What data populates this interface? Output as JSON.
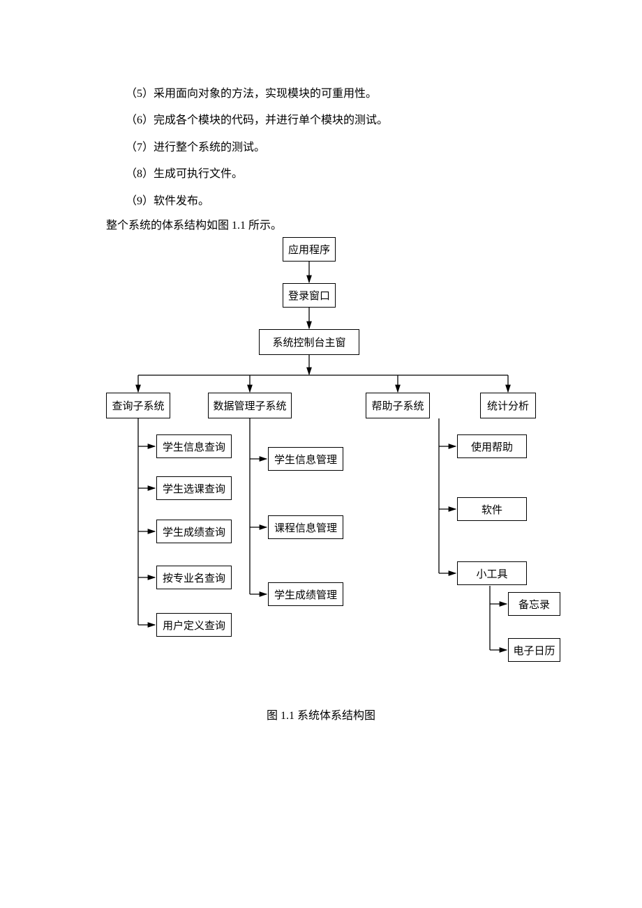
{
  "steps": {
    "s5": "（5）采用面向对象的方法，实现模块的可重用性。",
    "s6": "（6）完成各个模块的代码，并进行单个模块的测试。",
    "s7": "（7）进行整个系统的测试。",
    "s8": "（8）生成可执行文件。",
    "s9": "（9）软件发布。"
  },
  "summary": "整个系统的体系结构如图 1.1 所示。",
  "caption": "图 1.1 系统体系结构图",
  "nodes": {
    "app": "应用程序",
    "login": "登录窗口",
    "console": "系统控制台主窗",
    "query": "查询子系统",
    "datamgr": "数据管理子系统",
    "help": "帮助子系统",
    "stats": "统计分析",
    "q1": "学生信息查询",
    "q2": "学生选课查询",
    "q3": "学生成绩查询",
    "q4": "按专业名查询",
    "q5": "用户定义查询",
    "d1": "学生信息管理",
    "d2": "课程信息管理",
    "d3": "学生成绩管理",
    "h1": "使用帮助",
    "h2": "软件",
    "h3": "小工具",
    "h3a": "备忘录",
    "h3b": "电子日历"
  },
  "chart_data": {
    "type": "hierarchy",
    "title": "系统体系结构图",
    "root": "应用程序",
    "edges": [
      [
        "应用程序",
        "登录窗口"
      ],
      [
        "登录窗口",
        "系统控制台主窗"
      ],
      [
        "系统控制台主窗",
        "查询子系统"
      ],
      [
        "系统控制台主窗",
        "数据管理子系统"
      ],
      [
        "系统控制台主窗",
        "帮助子系统"
      ],
      [
        "系统控制台主窗",
        "统计分析"
      ],
      [
        "查询子系统",
        "学生信息查询"
      ],
      [
        "查询子系统",
        "学生选课查询"
      ],
      [
        "查询子系统",
        "学生成绩查询"
      ],
      [
        "查询子系统",
        "按专业名查询"
      ],
      [
        "查询子系统",
        "用户定义查询"
      ],
      [
        "数据管理子系统",
        "学生信息管理"
      ],
      [
        "数据管理子系统",
        "课程信息管理"
      ],
      [
        "数据管理子系统",
        "学生成绩管理"
      ],
      [
        "帮助子系统",
        "使用帮助"
      ],
      [
        "帮助子系统",
        "软件"
      ],
      [
        "帮助子系统",
        "小工具"
      ],
      [
        "小工具",
        "备忘录"
      ],
      [
        "小工具",
        "电子日历"
      ]
    ]
  }
}
